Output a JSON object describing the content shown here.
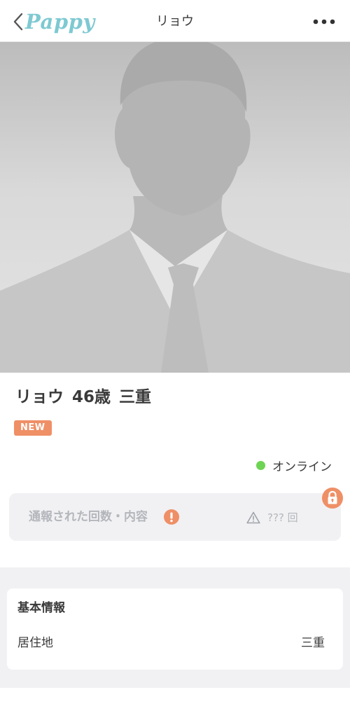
{
  "header": {
    "logo_text": "Pappy",
    "title": "リョウ",
    "back_icon": "chevron-left-icon",
    "more_icon": "more-dots-icon"
  },
  "photo": {
    "alt": "default silhouette profile photo"
  },
  "profile": {
    "name": "リョウ",
    "age": "46歳",
    "location": "三重",
    "badge": "NEW",
    "online_status": "オンライン"
  },
  "report": {
    "label": "通報された回数・内容",
    "count": "??? 回"
  },
  "basic_info": {
    "title": "基本情報",
    "rows": [
      {
        "label": "居住地",
        "value": "三重"
      }
    ]
  },
  "colors": {
    "brand": "#7ec9d2",
    "accent_orange": "#ef8f66",
    "online_green": "#6ed454",
    "muted_text": "#b3b6bb"
  }
}
